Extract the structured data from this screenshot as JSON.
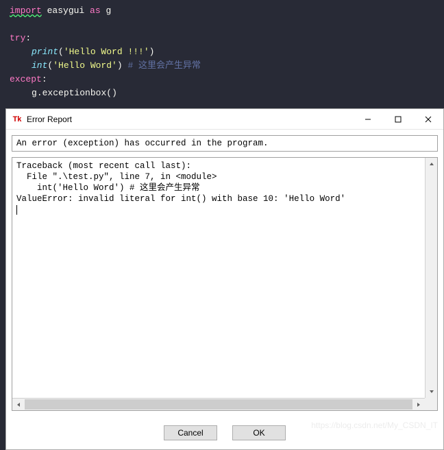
{
  "code": {
    "line1": {
      "import": "import",
      "mod": "easygui",
      "as": "as",
      "alias": "g"
    },
    "line3": {
      "try": "try",
      "colon": ":"
    },
    "line4": {
      "fn": "print",
      "lp": "(",
      "str": "'Hello Word !!!'",
      "rp": ")"
    },
    "line5": {
      "fn": "int",
      "lp": "(",
      "str": "'Hello Word'",
      "rp": ")",
      "comment": " # 这里会产生异常"
    },
    "line6": {
      "except": "except",
      "colon": ":"
    },
    "line7": {
      "obj": "g",
      "dot": ".",
      "attr": "exceptionbox",
      "lp": "(",
      "rp": ")"
    }
  },
  "dialog": {
    "title": "Error Report",
    "tk_icon": "Tk",
    "message": "An error (exception) has occurred in the program.",
    "traceback": "Traceback (most recent call last):\n  File \".\\test.py\", line 7, in <module>\n    int('Hello Word') # 这里会产生异常\nValueError: invalid literal for int() with base 10: 'Hello Word'",
    "buttons": {
      "cancel": "Cancel",
      "ok": "OK"
    }
  },
  "watermark": "https://blog.csdn.net/My_CSDN_IT"
}
